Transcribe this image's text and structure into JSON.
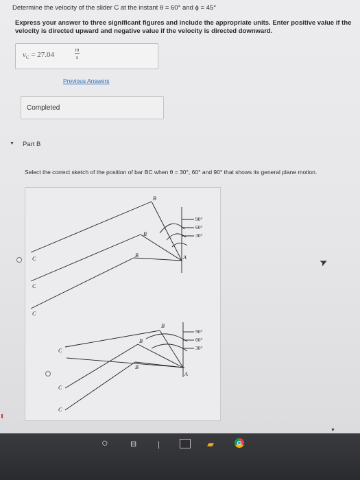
{
  "question": {
    "text": "Determine the velocity of the slider C at the instant θ = 60° and ϕ = 45°"
  },
  "instructions": {
    "text": "Express your answer to three significant figures and include the appropriate units. Enter positive value if the velocity is directed upward and negative value if the velocity is directed downward."
  },
  "answer": {
    "label": "v",
    "subscript": "C",
    "equals": "=",
    "value": "27.04",
    "unit_numerator": "m",
    "unit_denominator": "s"
  },
  "links": {
    "previous_answers": "Previous Answers"
  },
  "status": {
    "completed": "Completed"
  },
  "part_b": {
    "caret": "▼",
    "label": "Part B",
    "prompt": "Select the correct sketch of the position of bar BC when θ = 30°, 60° and 90° that shows its general plane motion."
  },
  "figure": {
    "options": [
      {
        "angle_labels": [
          "90°",
          "60°",
          "30°"
        ],
        "point_labels_B": [
          "B",
          "B",
          "B"
        ],
        "point_labels_C": [
          "C",
          "C",
          "C"
        ],
        "label_A": "A"
      },
      {
        "angle_labels": [
          "90°",
          "60°",
          "30°"
        ],
        "point_labels_B": [
          "B",
          "B",
          "B"
        ],
        "point_labels_C": [
          "C",
          "C",
          "C"
        ],
        "label_A": "A"
      }
    ]
  },
  "taskbar": {
    "icons": [
      "search-icon",
      "task-view-icon",
      "app-icon",
      "file-explorer-icon",
      "chrome-icon"
    ]
  }
}
